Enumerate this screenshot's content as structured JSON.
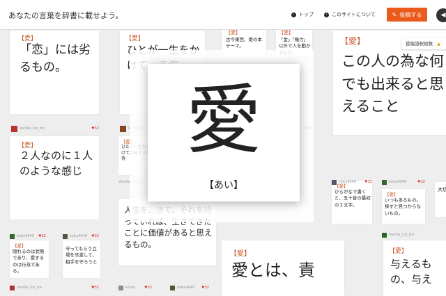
{
  "header": {
    "tagline": "あなたの言葉を辞書に載せよう。",
    "nav": [
      {
        "label": "トップ",
        "icon": "chevron-right-icon"
      },
      {
        "label": "このサイトについて",
        "icon": "chevron-right-icon"
      }
    ],
    "post_button": "投稿する",
    "round_button_icon": "sound-icon"
  },
  "tooltip": "投稿語釈総数",
  "heading_word": "【愛】",
  "modal": {
    "kanji": "愛",
    "reading": "【あい】"
  },
  "cards": [
    {
      "id": "c1",
      "text": "「恋」には劣るもの。"
    },
    {
      "id": "c2",
      "text": "ひとが一生をかけて…る気"
    },
    {
      "id": "c3",
      "text": "古今東西、愛の本テーマ。"
    },
    {
      "id": "c4",
      "text": "「金」「権力」以外で人を動かすもの"
    },
    {
      "id": "c5",
      "text": "この人の為な何でも出来ると思えること"
    },
    {
      "id": "c6",
      "text": "２人なのに１人のような感じ"
    },
    {
      "id": "c7",
      "text": "ひとが一生をかけて到達する気持"
    },
    {
      "id": "c8",
      "text": "人生を…きて、それを持っていれば、生きてきたことに価値があると思えるもの。"
    },
    {
      "id": "c9",
      "text": "ひらがなで書くと、五十音の最初の２文字。"
    },
    {
      "id": "c10",
      "text": "いつもあるもの。探すと見つからないもの。"
    },
    {
      "id": "c11",
      "text": "大切だよ。"
    },
    {
      "id": "c12",
      "text": "隠れるのは状態であり、愛するのは行為である。"
    },
    {
      "id": "c13",
      "text": "守ってもらう立場を卒業して、相手を守ろうと"
    },
    {
      "id": "c14",
      "text": "愛とは、責"
    },
    {
      "id": "c15",
      "text": "与えるもの、与え"
    }
  ],
  "meta": [
    {
      "id": "m1",
      "user": "Vanilla_Ice_Ice",
      "hearts": "32"
    },
    {
      "id": "m2",
      "user": "",
      "hearts": "32"
    },
    {
      "id": "m3",
      "user": "keita4649",
      "hearts": "32"
    },
    {
      "id": "m4",
      "user": "",
      "hearts": "32"
    },
    {
      "id": "m5",
      "user": "Vanilla_Ice_Ice",
      "hearts": ""
    },
    {
      "id": "m6",
      "user": "keita4649",
      "hearts": "32"
    },
    {
      "id": "m7",
      "user": "keita4649",
      "hearts": "32"
    },
    {
      "id": "m8",
      "user": "keita4649",
      "hearts": "32"
    },
    {
      "id": "m9",
      "user": "keita4649",
      "hearts": "32"
    },
    {
      "id": "m10",
      "user": "Vanilla_Ice_Ice",
      "hearts": ""
    },
    {
      "id": "m11",
      "user": "Vanilla_Ice_Ice",
      "hearts": "32"
    },
    {
      "id": "m12",
      "user": "kotoo",
      "hearts": "32"
    },
    {
      "id": "m13",
      "user": "keita4649",
      "hearts": "32"
    }
  ],
  "colors": {
    "accent": "#ea5a1c",
    "heading": "#c85a2a",
    "heart": "#dd3333"
  }
}
